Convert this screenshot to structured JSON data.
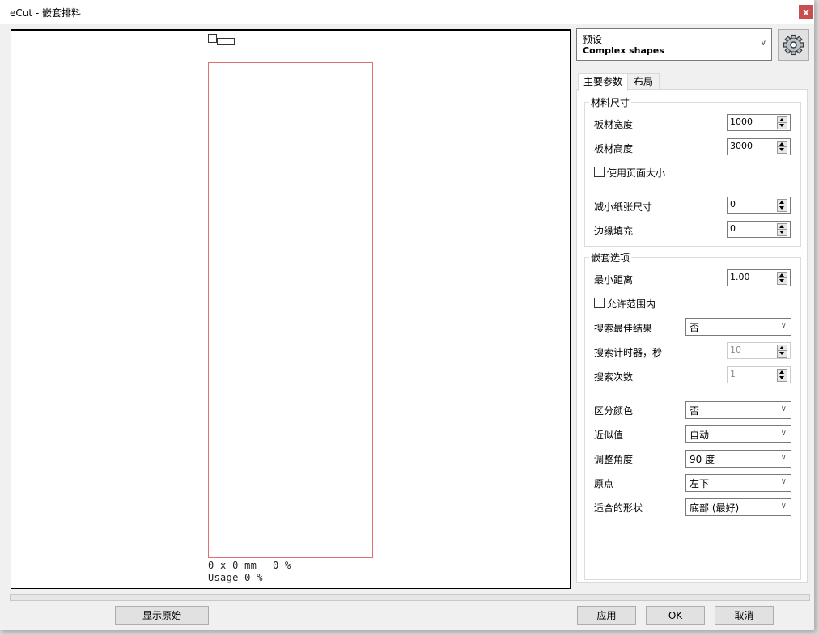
{
  "window": {
    "title": "eCut - 嵌套排料",
    "close_label": "x"
  },
  "preview": {
    "dimensions_readout": "0 x 0 mm",
    "percent_readout": "0 %",
    "usage_readout": "Usage 0 %"
  },
  "preset": {
    "label": "预设",
    "value": "Complex shapes"
  },
  "tabs": [
    {
      "label": "主要参数",
      "active": true
    },
    {
      "label": "布局",
      "active": false
    }
  ],
  "material_group": {
    "title": "材料尺寸",
    "sheet_width_label": "板材宽度",
    "sheet_width_value": "1000",
    "sheet_height_label": "板材高度",
    "sheet_height_value": "3000",
    "use_page_size_label": "使用页面大小",
    "use_page_size_checked": false,
    "reduce_paper_label": "减小纸张尺寸",
    "reduce_paper_value": "0",
    "edge_padding_label": "边缘填充",
    "edge_padding_value": "0"
  },
  "nesting_group": {
    "title": "嵌套选项",
    "min_distance_label": "最小距离",
    "min_distance_value": "1.00",
    "allow_inside_label": "允许范围内",
    "allow_inside_checked": false,
    "search_best_label": "搜索最佳结果",
    "search_best_value": "否",
    "search_timer_label": "搜索计时器，秒",
    "search_timer_value": "10",
    "search_count_label": "搜索次数",
    "search_count_value": "1",
    "distinguish_color_label": "区分颜色",
    "distinguish_color_value": "否",
    "approximation_label": "近似值",
    "approximation_value": "自动",
    "rotation_label": "调整角度",
    "rotation_value": "90 度",
    "origin_label": "原点",
    "origin_value": "左下",
    "fit_shape_label": "适合的形状",
    "fit_shape_value": "底部 (最好)"
  },
  "buttons": {
    "show_original": "显示原始",
    "apply": "应用",
    "ok": "OK",
    "cancel": "取消"
  },
  "icons": {
    "settings": "gear-icon",
    "dropdown": "chevron-down-icon",
    "close": "close-icon"
  },
  "colors": {
    "close_button": "#c94f4f",
    "sheet_outline": "#e07070"
  }
}
